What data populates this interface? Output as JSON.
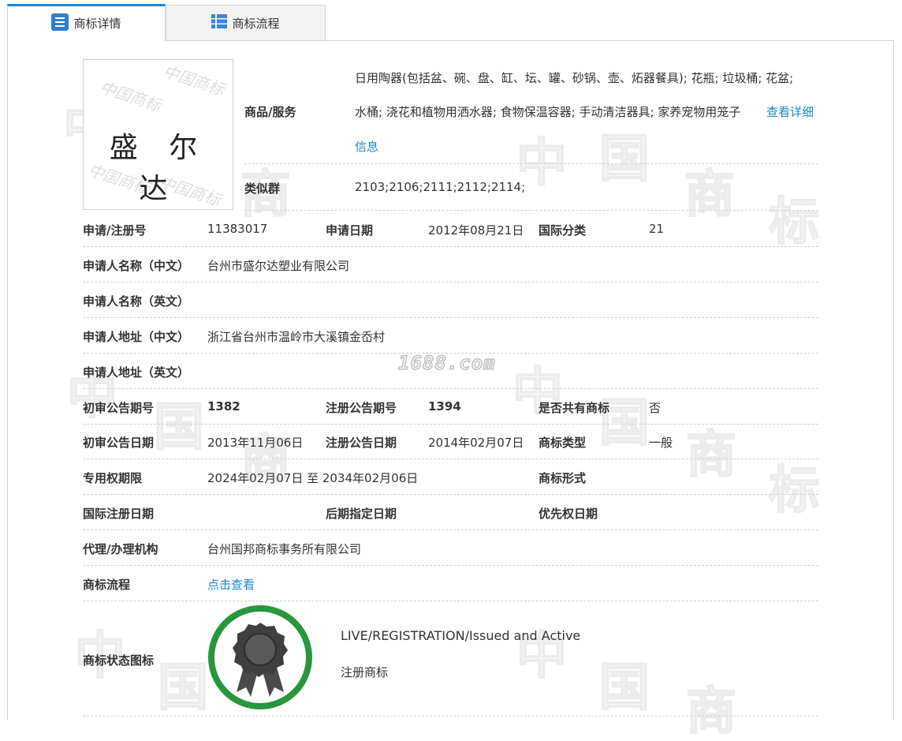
{
  "tabs": {
    "detail": "商标详情",
    "flow": "商标流程"
  },
  "watermark": {
    "site": "1688.com",
    "chars": [
      "中",
      "国",
      "商",
      "标"
    ]
  },
  "logo": {
    "text": "盛 尔 达",
    "bg_watermark": "中国商标"
  },
  "goods": {
    "label": "商品/服务",
    "line1": "日用陶器(包括盆、碗、盘、缸、坛、罐、砂锅、壶、炻器餐具); 花瓶; 垃圾桶; 花盆;",
    "line2": "水桶; 浇花和植物用洒水器; 食物保温容器; 手动清洁器具; 家养宠物用笼子",
    "more_link_1": "查看详细",
    "more_link_2": "信息"
  },
  "similar": {
    "label": "类似群",
    "value": "2103;2106;2111;2112;2114;"
  },
  "rows": {
    "reg_no_label": "申请/注册号",
    "reg_no": "11383017",
    "apply_date_label": "申请日期",
    "apply_date": "2012年08月21日",
    "intl_class_label": "国际分类",
    "intl_class": "21",
    "applicant_cn_label": "申请人名称（中文）",
    "applicant_cn": "台州市盛尔达塑业有限公司",
    "applicant_en_label": "申请人名称（英文）",
    "address_cn_label": "申请人地址（中文）",
    "address_cn": "浙江省台州市温岭市大溪镇金岙村",
    "address_en_label": "申请人地址（英文）",
    "prelim_no_label": "初审公告期号",
    "prelim_no": "1382",
    "reg_pub_no_label": "注册公告期号",
    "reg_pub_no": "1394",
    "shared_label": "是否共有商标",
    "shared": "否",
    "prelim_date_label": "初审公告日期",
    "prelim_date": "2013年11月06日",
    "reg_pub_date_label": "注册公告日期",
    "reg_pub_date": "2014年02月07日",
    "tm_type_label": "商标类型",
    "tm_type": "一般",
    "term_label": "专用权期限",
    "term": "2024年02月07日 至 2034年02月06日",
    "tm_form_label": "商标形式",
    "intl_reg_date_label": "国际注册日期",
    "later_date_label": "后期指定日期",
    "priority_date_label": "优先权日期",
    "agent_label": "代理/办理机构",
    "agent": "台州国邦商标事务所有限公司",
    "flow_label": "商标流程",
    "flow_link": "点击查看",
    "status_label": "商标状态图标",
    "status_en": "LIVE/REGISTRATION/Issued and Active",
    "status_cn": "注册商标"
  },
  "colors": {
    "link": "#1b87c9",
    "tab_accent": "#1e88d6",
    "status_ring": "#27963c"
  }
}
